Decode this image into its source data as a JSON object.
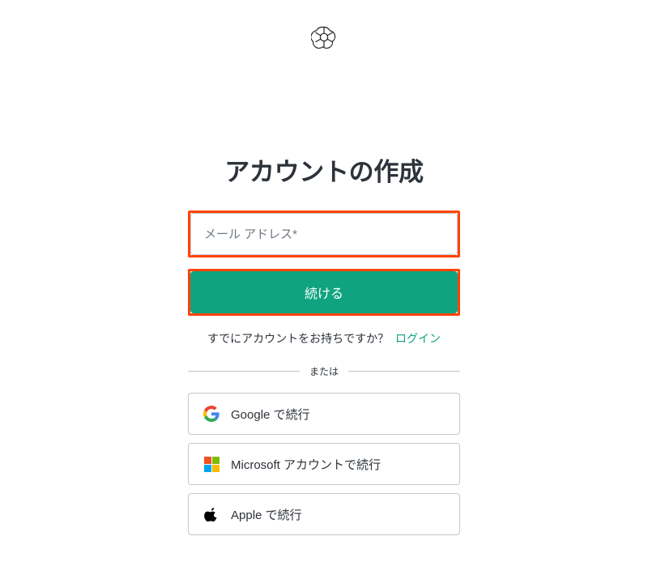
{
  "brand": {
    "logo_name": "openai-logo"
  },
  "auth": {
    "title": "アカウントの作成",
    "email_placeholder": "メール アドレス*",
    "continue_label": "続ける",
    "have_account_text": "すでにアカウントをお持ちですか？",
    "login_link_label": "ログイン",
    "divider_label": "または",
    "social": {
      "google_label": "Google で続行",
      "microsoft_label": "Microsoft アカウントで続行",
      "apple_label": "Apple で続行"
    }
  },
  "colors": {
    "accent": "#10a37f",
    "highlight": "#ff4400",
    "border": "#c2c8d0",
    "text": "#2d333a"
  }
}
